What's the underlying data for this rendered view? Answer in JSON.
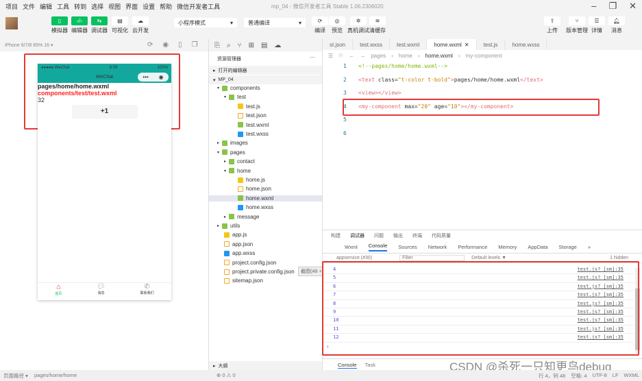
{
  "menu": [
    "项目",
    "文件",
    "编辑",
    "工具",
    "转到",
    "选择",
    "视图",
    "界面",
    "设置",
    "帮助",
    "微信开发者工具"
  ],
  "window_title": "mp_04 - 微信开发者工具 Stable 1.06.2306020",
  "toolbar": {
    "left": [
      "模拟器",
      "编辑器",
      "调试器",
      "可视化",
      "云开发"
    ],
    "mode": "小程序模式",
    "compile": "普通编译",
    "mid": [
      "编译",
      "预览",
      "真机调试",
      "清缓存"
    ],
    "right": [
      "上传",
      "版本管理",
      "详情",
      "消息"
    ]
  },
  "simulator": {
    "device": "iPhone 6/7/8 85% 16 ▾",
    "carrier": "●●●●● WeChat",
    "time": "8:09",
    "battery": "100%",
    "nav_title": "WeChat",
    "line1": "pages/home/home.wxml",
    "line2": "components/test/test.wxml",
    "count": "32",
    "button": "+1",
    "tabs": [
      "首页",
      "消息",
      "联系我们"
    ],
    "tab_active_color": "#07c160"
  },
  "tree": {
    "title": "资源管理器",
    "open_editors": "打开的编辑器",
    "project": "MP_04",
    "items": [
      {
        "name": "components",
        "depth": 0,
        "type": "folder"
      },
      {
        "name": "test",
        "depth": 1,
        "type": "folder"
      },
      {
        "name": "test.js",
        "depth": 2,
        "type": "js"
      },
      {
        "name": "test.json",
        "depth": 2,
        "type": "json"
      },
      {
        "name": "test.wxml",
        "depth": 2,
        "type": "wxml"
      },
      {
        "name": "test.wxss",
        "depth": 2,
        "type": "wxss"
      },
      {
        "name": "images",
        "depth": 0,
        "type": "folder"
      },
      {
        "name": "pages",
        "depth": 0,
        "type": "folder"
      },
      {
        "name": "contact",
        "depth": 1,
        "type": "folder"
      },
      {
        "name": "home",
        "depth": 1,
        "type": "folder"
      },
      {
        "name": "home.js",
        "depth": 2,
        "type": "js"
      },
      {
        "name": "home.json",
        "depth": 2,
        "type": "json"
      },
      {
        "name": "home.wxml",
        "depth": 2,
        "type": "wxml"
      },
      {
        "name": "home.wxss",
        "depth": 2,
        "type": "wxss"
      },
      {
        "name": "message",
        "depth": 1,
        "type": "folder"
      },
      {
        "name": "utils",
        "depth": 0,
        "type": "folder"
      },
      {
        "name": "app.js",
        "depth": 0,
        "type": "js"
      },
      {
        "name": "app.json",
        "depth": 0,
        "type": "json"
      },
      {
        "name": "app.wxss",
        "depth": 0,
        "type": "wxss"
      },
      {
        "name": "project.config.json",
        "depth": 0,
        "type": "json"
      },
      {
        "name": "project.private.config.json",
        "depth": 0,
        "type": "json"
      },
      {
        "name": "sitemap.json",
        "depth": 0,
        "type": "json"
      }
    ],
    "tooltip": "截图(Alt + A)",
    "outline": "大纲",
    "errors": "0",
    "warnings": "0"
  },
  "editor": {
    "tabs": [
      "st.json",
      "test.wxss",
      "test.wxml",
      "home.wxml",
      "test.js",
      "home.wxss"
    ],
    "active_tab": "home.wxml",
    "breadcrumb": [
      "pages",
      "home",
      "home.wxml",
      "my-component"
    ],
    "lines": [
      "<!--pages/home/home.wxml-->",
      "<text class=\"t-color t-bold\">pages/home/home.wxml</text>",
      "<view></view>",
      "<my-component max=\"20\" age=\"10\"></my-component>",
      "",
      ""
    ]
  },
  "devtools": {
    "top_tabs": [
      "构建",
      "调试器",
      "问题",
      "输出",
      "终端",
      "代码质量"
    ],
    "tabs": [
      "Wxml",
      "Console",
      "Sources",
      "Network",
      "Performance",
      "Memory",
      "AppData",
      "Storage",
      "»"
    ],
    "active": "Console",
    "context": "appservice (#30)",
    "filter_placeholder": "Filter",
    "levels": "Default levels ▼",
    "hidden": "1 hidden",
    "logs": [
      {
        "v": "4",
        "s": "test.js? [sm]:35"
      },
      {
        "v": "5",
        "s": "test.js? [sm]:35"
      },
      {
        "v": "6",
        "s": "test.js? [sm]:35"
      },
      {
        "v": "7",
        "s": "test.js? [sm]:35"
      },
      {
        "v": "8",
        "s": "test.js? [sm]:35"
      },
      {
        "v": "9",
        "s": "test.js? [sm]:35"
      },
      {
        "v": "10",
        "s": "test.js? [sm]:35"
      },
      {
        "v": "11",
        "s": "test.js? [sm]:35"
      },
      {
        "v": "12",
        "s": "test.js? [sm]:35"
      }
    ],
    "drawer_tabs": [
      "Console",
      "Task"
    ]
  },
  "statusbar": {
    "path_label": "页面路径 ▾",
    "path": "pages/home/home",
    "cursor": "行 4，列 48",
    "spaces": "空格: 4",
    "encoding": "UTF-8",
    "eol": "LF",
    "lang": "WXML"
  },
  "watermark": "CSDN @杀死一只知更鸟debug"
}
